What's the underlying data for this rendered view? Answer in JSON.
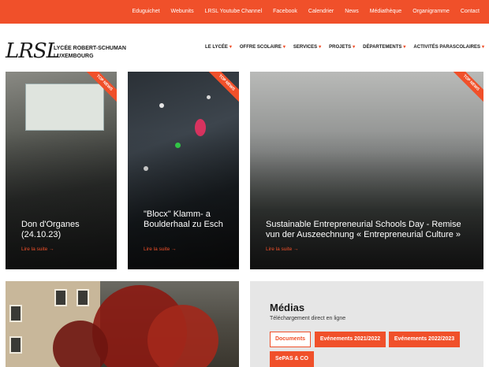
{
  "topbar": {
    "links": [
      "Eduguichet",
      "Webunits",
      "LRSL Youtube Channel",
      "Facebook",
      "Calendrier",
      "News",
      "Médiathèque",
      "Organigramme",
      "Contact"
    ]
  },
  "brand": {
    "logo_mark": "LRSL",
    "line1": "LYCÉE ROBERT-SCHUMAN",
    "line2": "LUXEMBOURG"
  },
  "nav": {
    "items": [
      "LE LYCÉE",
      "OFFRE SCOLAIRE",
      "SERVICES",
      "PROJETS",
      "DÉPARTEMENTS",
      "ACTIVITÉS PARASCOLAIRES"
    ]
  },
  "ribbon_label": "TOP NEWS",
  "read_more": "Lire la suite →",
  "news": [
    {
      "title": "Don d'Organes (24.10.23)"
    },
    {
      "title": "\"Blocx\" Klamm- a Boulderhaal zu Esch"
    },
    {
      "title": "Sustainable Entrepreneurial Schools Day - Remise vun der Auszeechnung « Entrepreneurial Culture »"
    }
  ],
  "media": {
    "title": "Médias",
    "subtitle": "Téléchargement direct en ligne",
    "buttons": [
      "Documents",
      "Evénements 2021/2022",
      "Evénements 2022/2023",
      "SePAS & CO"
    ]
  },
  "colors": {
    "accent": "#f0502a"
  }
}
